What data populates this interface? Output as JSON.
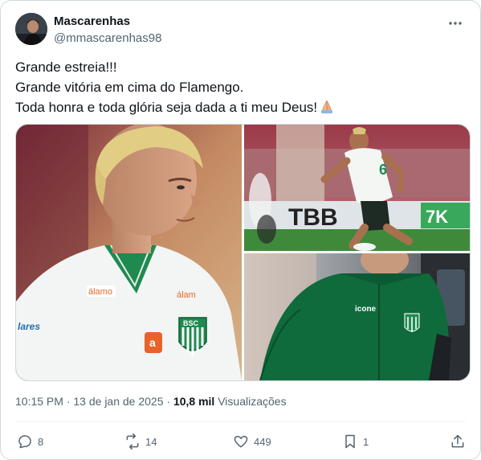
{
  "author": {
    "display_name": "Mascarenhas",
    "handle": "@mmascarenhas98",
    "avatar_icon": "profile-avatar"
  },
  "post": {
    "lines": [
      "Grande estreia!!!",
      "Grande vitória em cima do Flamengo.",
      "Toda honra e toda glória seja dada a ti meu Deus!"
    ],
    "emoji": "folded-hands-emoji"
  },
  "media": {
    "photo1": {
      "shirt_sponsor_1": "álamo",
      "shirt_sponsor_2": "álam",
      "chest_sponsor": "lares",
      "badge_text": "BSC",
      "sleeve_logo": "a"
    },
    "photo2": {
      "board_text": "TBB",
      "board_text_2": "7K",
      "shirt_number": "6"
    },
    "photo3": {
      "jacket_brand": "icone"
    }
  },
  "meta": {
    "time": "10:15 PM",
    "separator1": " · ",
    "date": "13 de jan de 2025",
    "separator2": " · ",
    "views_count": "10,8 mil",
    "views_label": "Visualizações"
  },
  "actions": {
    "reply_count": "8",
    "repost_count": "14",
    "like_count": "449",
    "bookmark_count": "1"
  },
  "colors": {
    "text": "#0f1419",
    "secondary": "#536471",
    "border": "#cfd9de",
    "club_green": "#1b7a45",
    "pitch_green": "#3e8a3a"
  }
}
